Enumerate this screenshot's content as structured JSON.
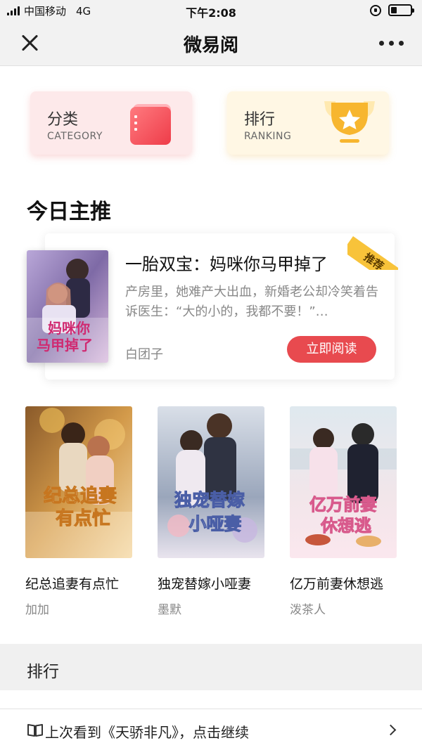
{
  "status_bar": {
    "carrier": "中国移动",
    "network": "4G",
    "time": "下午2:08"
  },
  "nav": {
    "title": "微易阅",
    "close_icon": "close-icon",
    "more_icon": "more-icon"
  },
  "entries": [
    {
      "title": "分类",
      "subtitle": "CATEGORY",
      "icon": "category-icon"
    },
    {
      "title": "排行",
      "subtitle": "RANKING",
      "icon": "trophy-icon"
    }
  ],
  "today": {
    "section_title": "今日主推",
    "badge": "推荐",
    "featured": {
      "title": "一胎双宝：妈咪你马甲掉了",
      "description": "产房里，她难产大出血，新婚老公却冷笑着告诉医生：“大的小的，我都不要！”…",
      "author": "白团子",
      "button": "立即阅读",
      "cover_text_line1": "妈咪你",
      "cover_text_line2": "马甲掉了"
    }
  },
  "books": [
    {
      "title": "纪总追妻有点忙",
      "author": "加加",
      "cover_line1": "纪总追妻",
      "cover_line2": "有点忙"
    },
    {
      "title": "独宠替嫁小哑妻",
      "author": "墨默",
      "cover_line1": "独宠替嫁",
      "cover_line2": "小哑妻"
    },
    {
      "title": "亿万前妻休想逃",
      "author": "泼茶人",
      "cover_line1": "亿万前妻",
      "cover_line2": "休想逃"
    }
  ],
  "ranking": {
    "title": "排行"
  },
  "continue": {
    "text": "上次看到《天骄非凡》，点击继续",
    "icon": "book-icon",
    "chevron": "chevron-right-icon"
  },
  "colors": {
    "accent": "#e84a4f",
    "badge": "#f8c33a",
    "category_bg": "#fde9ea",
    "ranking_bg": "#fff7e4"
  }
}
